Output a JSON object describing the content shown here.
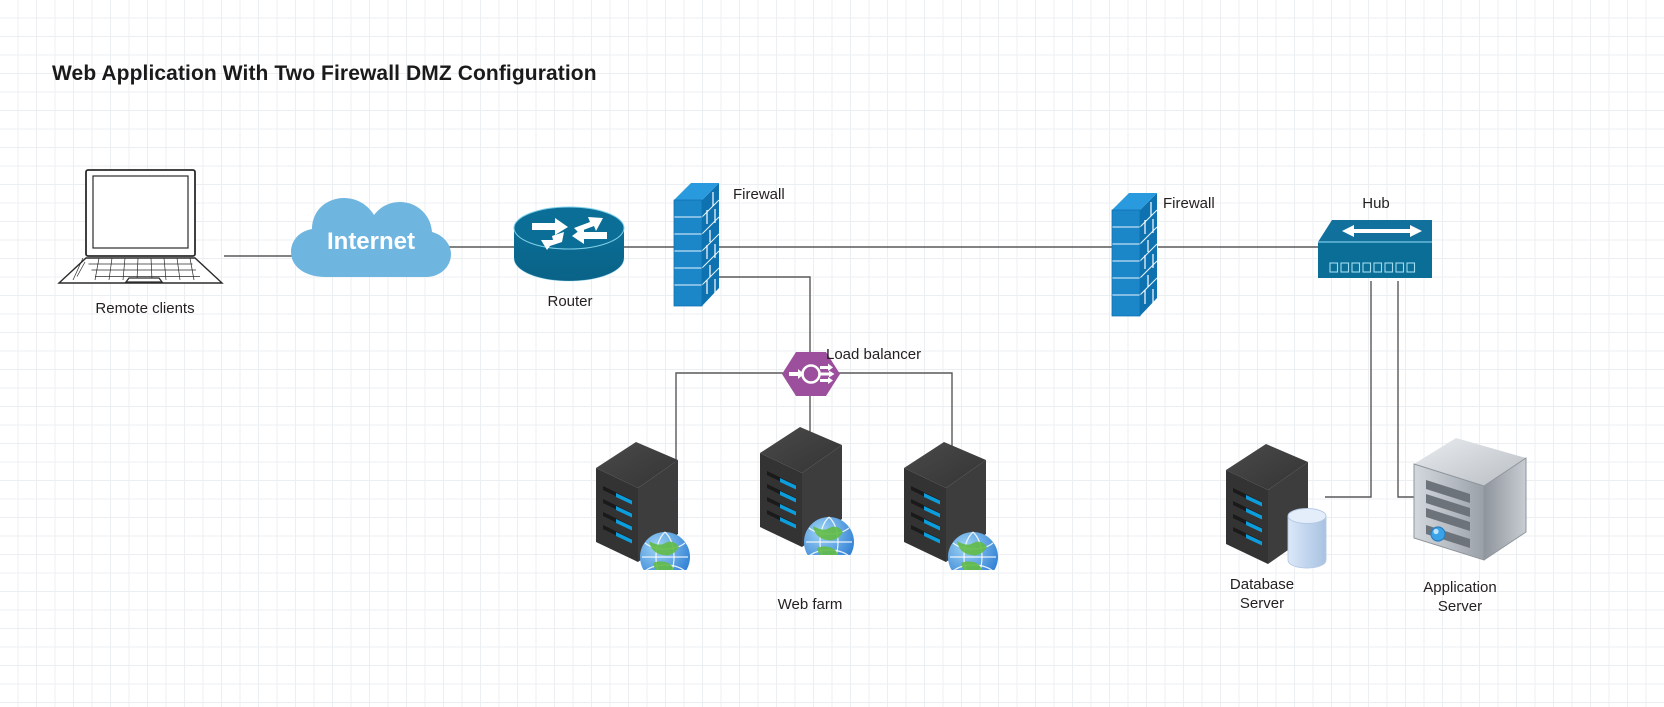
{
  "diagram": {
    "title": "Web Application With Two Firewall DMZ Configuration",
    "background": "graph-paper-grid",
    "grid_minor_color": "#eceff1",
    "grid_major_color": "#d7dbdd",
    "link_color": "#595959"
  },
  "palette": {
    "cloud_blue": "#6eb5e0",
    "cisco_teal": "#0b6e96",
    "firewall_blue": "#1b87c9",
    "firewall_blue_dark": "#0f72b0",
    "load_balancer_purple": "#9c4f9c",
    "server_dark": "#3a3a3a",
    "server_led": "#0d9ddb",
    "appserver_silver": "#b6bbc0",
    "db_cylinder": "#c7d8ef",
    "text": "#231f20"
  },
  "nodes": [
    {
      "id": "remote-clients",
      "label": "Remote clients",
      "icon": "laptop-icon"
    },
    {
      "id": "internet",
      "label": "Internet",
      "icon": "cloud-icon"
    },
    {
      "id": "router",
      "label": "Router",
      "icon": "router-icon"
    },
    {
      "id": "firewall-outer",
      "label": "Firewall",
      "icon": "firewall-icon"
    },
    {
      "id": "load-balancer",
      "label": "Load balancer",
      "icon": "load-balancer-icon"
    },
    {
      "id": "web-server-1",
      "label": "",
      "icon": "web-server-icon"
    },
    {
      "id": "web-server-2",
      "label": "Web farm",
      "icon": "web-server-icon"
    },
    {
      "id": "web-server-3",
      "label": "",
      "icon": "web-server-icon"
    },
    {
      "id": "firewall-inner",
      "label": "Firewall",
      "icon": "firewall-icon"
    },
    {
      "id": "hub",
      "label": "Hub",
      "icon": "hub-icon"
    },
    {
      "id": "database-server",
      "label": "Database\nServer",
      "icon": "database-server-icon"
    },
    {
      "id": "app-server",
      "label": "Application\nServer",
      "icon": "application-server-icon"
    }
  ],
  "labels": {
    "remote_clients": "Remote clients",
    "internet": "Internet",
    "router": "Router",
    "firewall_outer": "Firewall",
    "load_balancer": "Load balancer",
    "web_farm": "Web farm",
    "firewall_inner": "Firewall",
    "hub": "Hub",
    "database_server": "Database\nServer",
    "application_server": "Application\nServer"
  },
  "links": [
    {
      "from": "remote-clients",
      "to": "internet"
    },
    {
      "from": "internet",
      "to": "router"
    },
    {
      "from": "router",
      "to": "firewall-outer"
    },
    {
      "from": "firewall-outer",
      "to": "firewall-inner"
    },
    {
      "from": "firewall-outer",
      "to": "load-balancer"
    },
    {
      "from": "load-balancer",
      "to": "web-server-1"
    },
    {
      "from": "load-balancer",
      "to": "web-server-2"
    },
    {
      "from": "load-balancer",
      "to": "web-server-3"
    },
    {
      "from": "firewall-inner",
      "to": "hub"
    },
    {
      "from": "hub",
      "to": "database-server"
    },
    {
      "from": "hub",
      "to": "app-server"
    }
  ]
}
